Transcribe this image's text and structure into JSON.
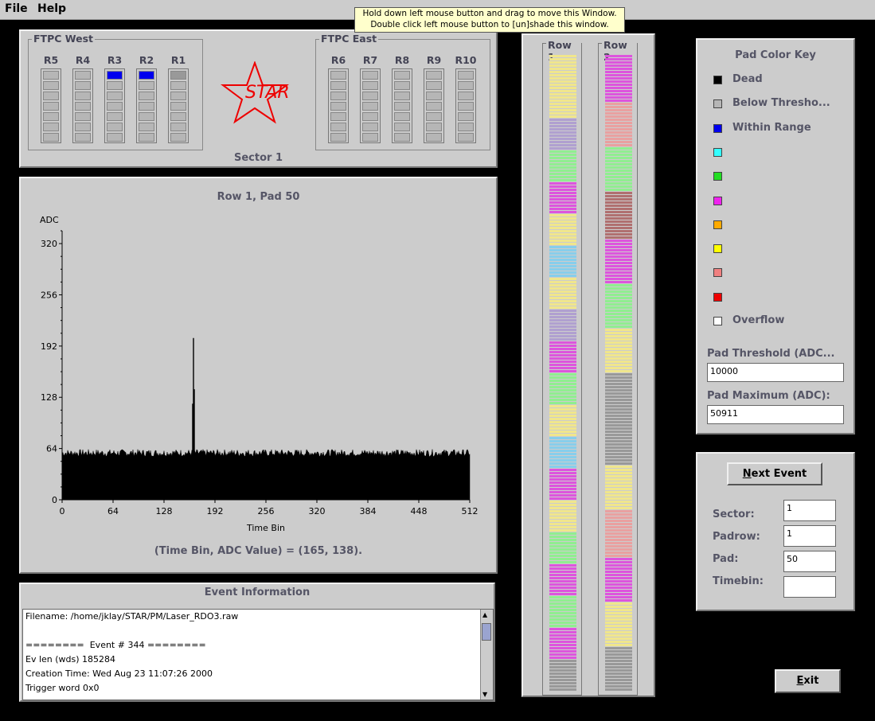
{
  "menubar": {
    "file_label": "File",
    "help_label": "Help"
  },
  "tooltip": {
    "line1": "Hold down left mouse button and drag to move this Window.",
    "line2": "Double click left mouse button to [un]shade this window."
  },
  "sector_panel": {
    "west_title": "FTPC West",
    "east_title": "FTPC East",
    "west_columns": [
      {
        "label": "R5",
        "top_color": ""
      },
      {
        "label": "R4",
        "top_color": ""
      },
      {
        "label": "R3",
        "top_color": "#0000ee"
      },
      {
        "label": "R2",
        "top_color": "#0000ee"
      },
      {
        "label": "R1",
        "top_color": "#999999"
      }
    ],
    "east_columns": [
      {
        "label": "R6",
        "top_color": ""
      },
      {
        "label": "R7",
        "top_color": ""
      },
      {
        "label": "R8",
        "top_color": ""
      },
      {
        "label": "R9",
        "top_color": ""
      },
      {
        "label": "R10",
        "top_color": ""
      }
    ],
    "logo_text": "STAR",
    "sector_label": "Sector 1"
  },
  "plot_panel": {
    "readout": "(Time Bin, ADC Value) = (165, 138)."
  },
  "chart_data": {
    "type": "bar",
    "title": "Row 1, Pad 50",
    "xlabel": "Time Bin",
    "ylabel": "ADC",
    "xlim": [
      0,
      512
    ],
    "ylim": [
      0,
      336
    ],
    "xticks": [
      0,
      64,
      128,
      192,
      256,
      320,
      384,
      448,
      512
    ],
    "yticks": [
      0,
      64,
      128,
      192,
      256,
      320
    ],
    "baseline": 60,
    "spikes": [
      {
        "x": 165,
        "y": 202
      },
      {
        "x": 166,
        "y": 138
      },
      {
        "x": 164,
        "y": 120
      }
    ],
    "grid": false
  },
  "event_info": {
    "title": "Event Information",
    "lines": [
      "Filename: /home/jklay/STAR/PM/Laser_RDO3.raw",
      "",
      "========  Event # 344 ========",
      "Ev len (wds) 185284",
      "Creation Time: Wed Aug 23 11:07:26 2000",
      "Trigger word 0x0"
    ]
  },
  "rows_panel": {
    "row1_label": "Row 1",
    "row2_label": "Row 2",
    "row1_bands": [
      "#f0e68c",
      "#f0e68c",
      "#b0a0d0",
      "#90ee90",
      "#dd55dd",
      "#f0e68c",
      "#87ceeb",
      "#f0e68c",
      "#b0a0d0",
      "#dd55dd",
      "#90ee90",
      "#f0e68c",
      "#87ceeb",
      "#dd55dd",
      "#f0e68c",
      "#90ee90",
      "#dd55dd",
      "#90ee90",
      "#dd55dd",
      "#999999"
    ],
    "row2_bands": [
      "#dd55dd",
      "#e9a0a0",
      "#90ee90",
      "#b07070",
      "#dd55dd",
      "#90ee90",
      "#f0e68c",
      "#999999",
      "#999999",
      "#f0e68c",
      "#e9a0a0",
      "#dd55dd",
      "#f0e68c",
      "#999999"
    ]
  },
  "color_key": {
    "title": "Pad Color Key",
    "items": [
      {
        "color": "#000000",
        "label": "Dead"
      },
      {
        "color": "#b6b6b6",
        "label": "Below Thresho..."
      },
      {
        "color": "#0000ee",
        "label": "Within Range"
      },
      {
        "color": "#33ffff",
        "label": ""
      },
      {
        "color": "#22dd22",
        "label": ""
      },
      {
        "color": "#ee22ee",
        "label": ""
      },
      {
        "color": "#ffaa00",
        "label": ""
      },
      {
        "color": "#ffff00",
        "label": ""
      },
      {
        "color": "#f08080",
        "label": ""
      },
      {
        "color": "#ee0000",
        "label": ""
      },
      {
        "color": "#ffffff",
        "label": "Overflow"
      }
    ],
    "threshold_label": "Pad Threshold (ADC...",
    "threshold_value": "10000",
    "maximum_label": "Pad Maximum (ADC):",
    "maximum_value": "50911"
  },
  "controls": {
    "next_event_prefix": "N",
    "next_event_rest": "ext Event",
    "sector_label": "Sector:",
    "sector_value": "1",
    "padrow_label": "Padrow:",
    "padrow_value": "1",
    "pad_label": "Pad:",
    "pad_value": "50",
    "timebin_label": "Timebin:",
    "timebin_value": ""
  },
  "exit": {
    "prefix": "E",
    "rest": "xit"
  }
}
